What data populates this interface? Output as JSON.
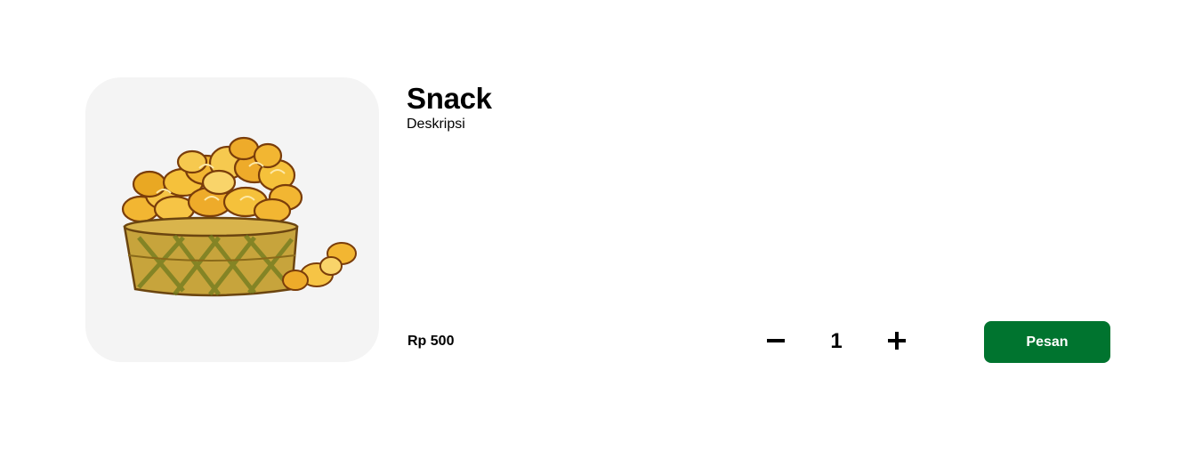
{
  "product": {
    "name": "Snack",
    "description": "Deskripsi",
    "price": "Rp 500",
    "image_icon": "snack-basket-image"
  },
  "stepper": {
    "minus_icon": "minus-icon",
    "plus_icon": "plus-icon",
    "quantity": "1"
  },
  "actions": {
    "order_label": "Pesan"
  },
  "colors": {
    "image_background": "#f4f4f4",
    "order_button": "#00742f",
    "order_text": "#ffffff",
    "text": "#000000"
  }
}
